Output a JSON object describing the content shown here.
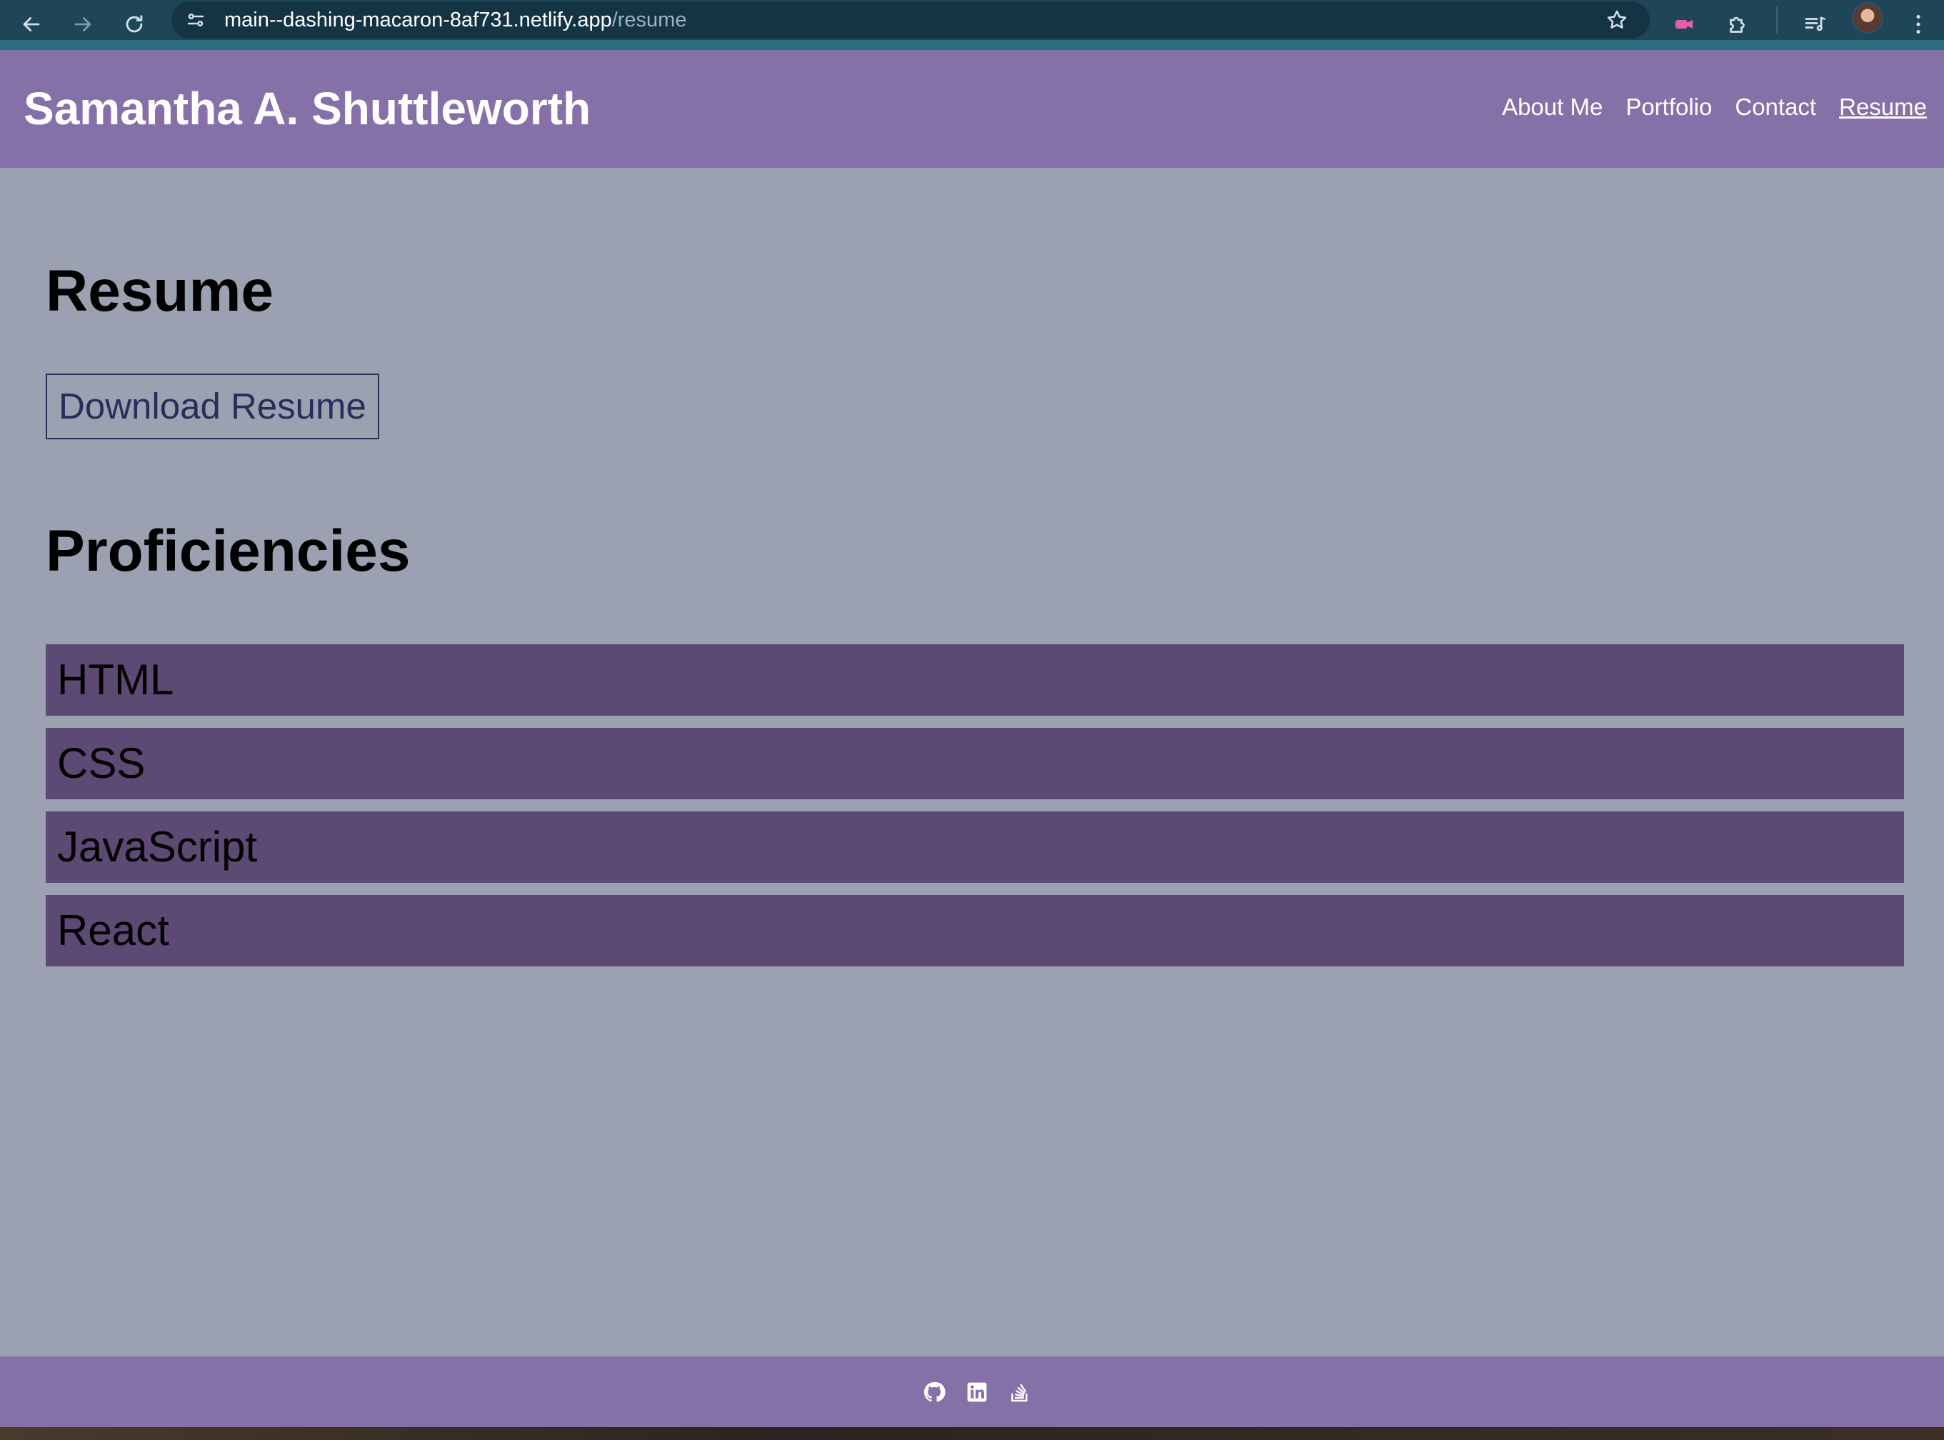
{
  "browser": {
    "url_host": "main--dashing-macaron-8af731.netlify.app",
    "url_path": "/resume",
    "icons": [
      "back-icon",
      "forward-icon",
      "reload-icon",
      "site-info-icon",
      "bookmark-star-icon",
      "extension-video-icon",
      "extensions-puzzle-icon",
      "media-queue-icon",
      "profile-avatar",
      "menu-kebab-icon"
    ]
  },
  "header": {
    "title": "Samantha A. Shuttleworth",
    "nav": [
      {
        "label": "About Me",
        "active": false
      },
      {
        "label": "Portfolio",
        "active": false
      },
      {
        "label": "Contact",
        "active": false
      },
      {
        "label": "Resume",
        "active": true
      }
    ]
  },
  "main": {
    "resume_heading": "Resume",
    "download_label": "Download Resume",
    "proficiencies_heading": "Proficiencies",
    "proficiencies": [
      "HTML",
      "CSS",
      "JavaScript",
      "React"
    ]
  },
  "footer": {
    "icons": [
      "github-icon",
      "linkedin-icon",
      "stackoverflow-icon"
    ]
  },
  "colors": {
    "browser_bar": "#1e4658",
    "header_bg": "#8570a8",
    "page_bg": "#9ca1b1",
    "proficiency_bg": "#5c4a74",
    "button_border": "#2b2c5a"
  }
}
